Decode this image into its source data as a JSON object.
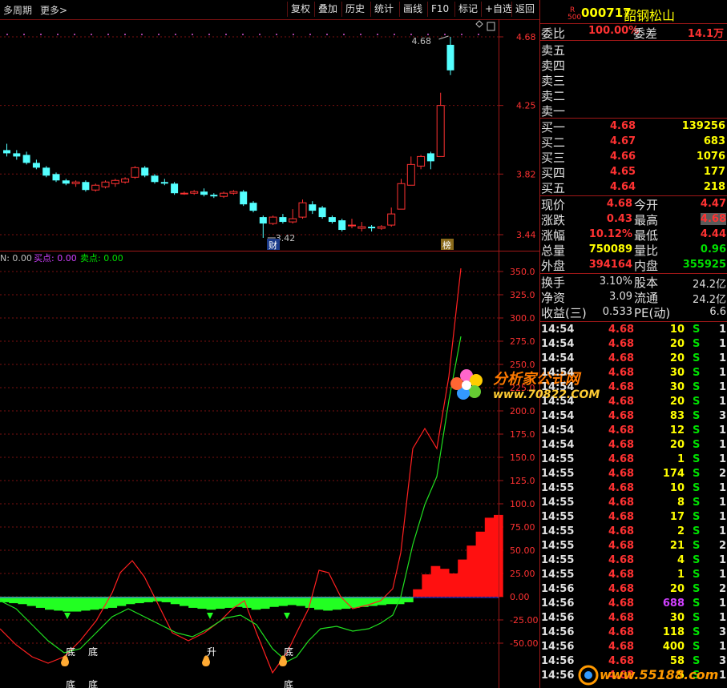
{
  "toolbar": {
    "period_label": "多周期",
    "more_label": "更多>",
    "buttons": [
      "复权",
      "叠加",
      "历史",
      "统计",
      "画线",
      "F10",
      "标记",
      "+自选",
      "返回"
    ]
  },
  "stock": {
    "badge_top": "R",
    "badge_bottom": "500",
    "code": "000717",
    "name": "韶钢松山"
  },
  "colors": {
    "up": "#ff3232",
    "down": "#54ffff",
    "green": "#00e000",
    "white": "#e0e0e0",
    "purple": "#d040ff",
    "grid": "#7a1010"
  },
  "order_ratio": {
    "label1": "委比",
    "value1": "100.00%",
    "label2": "委差",
    "value2": "14.1万"
  },
  "asks": [
    {
      "label": "卖五"
    },
    {
      "label": "卖四"
    },
    {
      "label": "卖三"
    },
    {
      "label": "卖二"
    },
    {
      "label": "卖一"
    }
  ],
  "bids": [
    {
      "label": "买一",
      "price": "4.68",
      "vol": "139256"
    },
    {
      "label": "买二",
      "price": "4.67",
      "vol": "683"
    },
    {
      "label": "买三",
      "price": "4.66",
      "vol": "1076"
    },
    {
      "label": "买四",
      "price": "4.65",
      "vol": "177"
    },
    {
      "label": "买五",
      "price": "4.64",
      "vol": "218"
    }
  ],
  "stats": [
    {
      "l1": "现价",
      "v1": "4.68",
      "c1": "up",
      "l2": "今开",
      "v2": "4.47",
      "c2": "up"
    },
    {
      "l1": "涨跌",
      "v1": "0.43",
      "c1": "up",
      "l2": "最高",
      "v2": "4.68",
      "c2": "up",
      "hl2": true
    },
    {
      "l1": "涨幅",
      "v1": "10.12%",
      "c1": "up",
      "l2": "最低",
      "v2": "4.44",
      "c2": "up"
    },
    {
      "l1": "总量",
      "v1": "750089",
      "c1": "yellow",
      "l2": "量比",
      "v2": "0.96",
      "c2": "green"
    },
    {
      "l1": "外盘",
      "v1": "394164",
      "c1": "up",
      "l2": "内盘",
      "v2": "355925",
      "c2": "green"
    }
  ],
  "fin": [
    {
      "l1": "换手",
      "v1": "3.10%",
      "l2": "股本",
      "v2": "24.2亿"
    },
    {
      "l1": "净资",
      "v1": "3.09",
      "l2": "流通",
      "v2": "24.2亿"
    },
    {
      "l1": "收益(三)",
      "v1": "0.533",
      "l2": "PE(动)",
      "v2": "6.6"
    }
  ],
  "ticks": [
    {
      "t": "14:54",
      "p": "4.68",
      "v": "10",
      "s": "S",
      "n": "1"
    },
    {
      "t": "14:54",
      "p": "4.68",
      "v": "20",
      "s": "S",
      "n": "1"
    },
    {
      "t": "14:54",
      "p": "4.68",
      "v": "20",
      "s": "S",
      "n": "1"
    },
    {
      "t": "14:54",
      "p": "4.68",
      "v": "30",
      "s": "S",
      "n": "1"
    },
    {
      "t": "14:54",
      "p": "4.68",
      "v": "30",
      "s": "S",
      "n": "1"
    },
    {
      "t": "14:54",
      "p": "4.68",
      "v": "20",
      "s": "S",
      "n": "1"
    },
    {
      "t": "14:54",
      "p": "4.68",
      "v": "83",
      "s": "S",
      "n": "3"
    },
    {
      "t": "14:54",
      "p": "4.68",
      "v": "12",
      "s": "S",
      "n": "1"
    },
    {
      "t": "14:54",
      "p": "4.68",
      "v": "20",
      "s": "S",
      "n": "1"
    },
    {
      "t": "14:55",
      "p": "4.68",
      "v": "1",
      "s": "S",
      "n": "1"
    },
    {
      "t": "14:55",
      "p": "4.68",
      "v": "174",
      "s": "S",
      "n": "2"
    },
    {
      "t": "14:55",
      "p": "4.68",
      "v": "10",
      "s": "S",
      "n": "1"
    },
    {
      "t": "14:55",
      "p": "4.68",
      "v": "8",
      "s": "S",
      "n": "1"
    },
    {
      "t": "14:55",
      "p": "4.68",
      "v": "17",
      "s": "S",
      "n": "1"
    },
    {
      "t": "14:55",
      "p": "4.68",
      "v": "2",
      "s": "S",
      "n": "1"
    },
    {
      "t": "14:55",
      "p": "4.68",
      "v": "21",
      "s": "S",
      "n": "2"
    },
    {
      "t": "14:55",
      "p": "4.68",
      "v": "4",
      "s": "S",
      "n": "1"
    },
    {
      "t": "14:55",
      "p": "4.68",
      "v": "1",
      "s": "S",
      "n": "1"
    },
    {
      "t": "14:56",
      "p": "4.68",
      "v": "20",
      "s": "S",
      "n": "2"
    },
    {
      "t": "14:56",
      "p": "4.68",
      "v": "688",
      "s": "S",
      "n": "1",
      "big": true
    },
    {
      "t": "14:56",
      "p": "4.68",
      "v": "30",
      "s": "S",
      "n": "1"
    },
    {
      "t": "14:56",
      "p": "4.68",
      "v": "118",
      "s": "S",
      "n": "3"
    },
    {
      "t": "14:56",
      "p": "4.68",
      "v": "400",
      "s": "S",
      "n": "1"
    },
    {
      "t": "14:56",
      "p": "4.68",
      "v": "58",
      "s": "S",
      "n": "3"
    },
    {
      "t": "14:56",
      "p": "4.68",
      "v": "5",
      "s": "S",
      "n": "1"
    }
  ],
  "price_axis": [
    "4.68",
    "4.25",
    "3.82",
    "3.44"
  ],
  "price_chart": {
    "high_label": "4.68",
    "low_label": "3.42",
    "marker_cai": "财",
    "marker_bang": "榜",
    "candles": [
      {
        "o": 3.97,
        "h": 4.01,
        "l": 3.93,
        "c": 3.95
      },
      {
        "o": 3.95,
        "h": 3.97,
        "l": 3.91,
        "c": 3.93
      },
      {
        "o": 3.94,
        "h": 3.96,
        "l": 3.88,
        "c": 3.89
      },
      {
        "o": 3.89,
        "h": 3.91,
        "l": 3.85,
        "c": 3.86
      },
      {
        "o": 3.86,
        "h": 3.87,
        "l": 3.8,
        "c": 3.81
      },
      {
        "o": 3.82,
        "h": 3.83,
        "l": 3.77,
        "c": 3.78
      },
      {
        "o": 3.78,
        "h": 3.79,
        "l": 3.75,
        "c": 3.76
      },
      {
        "o": 3.76,
        "h": 3.78,
        "l": 3.74,
        "c": 3.77
      },
      {
        "o": 3.77,
        "h": 3.78,
        "l": 3.71,
        "c": 3.72
      },
      {
        "o": 3.72,
        "h": 3.76,
        "l": 3.71,
        "c": 3.75
      },
      {
        "o": 3.74,
        "h": 3.78,
        "l": 3.73,
        "c": 3.77
      },
      {
        "o": 3.76,
        "h": 3.79,
        "l": 3.74,
        "c": 3.78
      },
      {
        "o": 3.77,
        "h": 3.8,
        "l": 3.76,
        "c": 3.79
      },
      {
        "o": 3.8,
        "h": 3.87,
        "l": 3.79,
        "c": 3.86
      },
      {
        "o": 3.86,
        "h": 3.87,
        "l": 3.8,
        "c": 3.81
      },
      {
        "o": 3.81,
        "h": 3.82,
        "l": 3.76,
        "c": 3.77
      },
      {
        "o": 3.77,
        "h": 3.79,
        "l": 3.75,
        "c": 3.76
      },
      {
        "o": 3.76,
        "h": 3.77,
        "l": 3.69,
        "c": 3.7
      },
      {
        "o": 3.7,
        "h": 3.71,
        "l": 3.69,
        "c": 3.7
      },
      {
        "o": 3.7,
        "h": 3.72,
        "l": 3.69,
        "c": 3.71
      },
      {
        "o": 3.71,
        "h": 3.73,
        "l": 3.68,
        "c": 3.69
      },
      {
        "o": 3.69,
        "h": 3.7,
        "l": 3.67,
        "c": 3.68
      },
      {
        "o": 3.68,
        "h": 3.71,
        "l": 3.67,
        "c": 3.7
      },
      {
        "o": 3.7,
        "h": 3.72,
        "l": 3.69,
        "c": 3.71
      },
      {
        "o": 3.71,
        "h": 3.72,
        "l": 3.62,
        "c": 3.63
      },
      {
        "o": 3.64,
        "h": 3.65,
        "l": 3.58,
        "c": 3.59
      },
      {
        "o": 3.55,
        "h": 3.56,
        "l": 3.42,
        "c": 3.51
      },
      {
        "o": 3.51,
        "h": 3.56,
        "l": 3.5,
        "c": 3.55
      },
      {
        "o": 3.55,
        "h": 3.57,
        "l": 3.51,
        "c": 3.52
      },
      {
        "o": 3.52,
        "h": 3.6,
        "l": 3.51,
        "c": 3.54
      },
      {
        "o": 3.55,
        "h": 3.66,
        "l": 3.54,
        "c": 3.64
      },
      {
        "o": 3.63,
        "h": 3.65,
        "l": 3.57,
        "c": 3.59
      },
      {
        "o": 3.61,
        "h": 3.62,
        "l": 3.54,
        "c": 3.55
      },
      {
        "o": 3.55,
        "h": 3.56,
        "l": 3.51,
        "c": 3.52
      },
      {
        "o": 3.53,
        "h": 3.54,
        "l": 3.46,
        "c": 3.47
      },
      {
        "o": 3.5,
        "h": 3.54,
        "l": 3.48,
        "c": 3.5
      },
      {
        "o": 3.48,
        "h": 3.52,
        "l": 3.46,
        "c": 3.49
      },
      {
        "o": 3.49,
        "h": 3.5,
        "l": 3.46,
        "c": 3.48
      },
      {
        "o": 3.48,
        "h": 3.5,
        "l": 3.47,
        "c": 3.49
      },
      {
        "o": 3.5,
        "h": 3.61,
        "l": 3.49,
        "c": 3.57
      },
      {
        "o": 3.6,
        "h": 3.79,
        "l": 3.6,
        "c": 3.76
      },
      {
        "o": 3.75,
        "h": 3.93,
        "l": 3.75,
        "c": 3.88
      },
      {
        "o": 3.87,
        "h": 3.94,
        "l": 3.85,
        "c": 3.93
      },
      {
        "o": 3.95,
        "h": 3.96,
        "l": 3.85,
        "c": 3.9
      },
      {
        "o": 3.93,
        "h": 4.33,
        "l": 3.93,
        "c": 4.25
      },
      {
        "o": 4.63,
        "h": 4.68,
        "l": 4.44,
        "c": 4.47
      }
    ]
  },
  "indicator": {
    "label_n": "N: 0.00",
    "label_buy": "买点: 0.00",
    "label_sell": "卖点: 0.00",
    "axis": [
      "350.0",
      "325.0",
      "300.0",
      "275.0",
      "250.0",
      "225.0",
      "200.0",
      "175.0",
      "150.0",
      "125.0",
      "100.0",
      "75.00",
      "50.00",
      "25.00",
      "0.00",
      "-25.00",
      "-50.00"
    ],
    "marker_texts": [
      "底",
      "底",
      "升",
      "底",
      "底",
      "底",
      "底"
    ]
  },
  "watermark": {
    "line1": "分析家公式网",
    "line2": "www.70822.COM"
  },
  "watermark2": {
    "text": "www.55188.com"
  }
}
